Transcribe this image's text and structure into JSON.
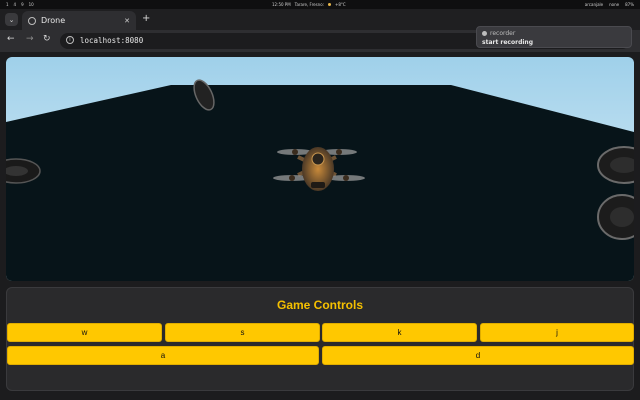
{
  "os_bar": {
    "workspaces": [
      "1",
      "4",
      "9",
      "10"
    ],
    "time": "12:50 PM",
    "location": "Tarare, Fresno:",
    "temperature": "+8°C",
    "right_items": [
      "arcanjale",
      "none",
      "87%"
    ]
  },
  "browser": {
    "tab_title": "Drone",
    "new_tab_label": "+",
    "url": "localhost:8080"
  },
  "recorder": {
    "title": "recorder",
    "action": "start recording"
  },
  "game": {
    "controls_title": "Game Controls",
    "buttons_row1": [
      "w",
      "s",
      "k",
      "j"
    ],
    "buttons_row2": [
      "a",
      "d"
    ]
  },
  "colors": {
    "accent": "#ffc800",
    "title": "#f5c000",
    "scene_bg": "#061318",
    "panel_bg": "#2a2a2c"
  },
  "icons": [
    "menu-chevron-icon",
    "globe-icon",
    "close-icon",
    "back-arrow-icon",
    "forward-arrow-icon",
    "reload-icon",
    "info-icon",
    "star-icon",
    "extension-icon",
    "profile-icon"
  ]
}
